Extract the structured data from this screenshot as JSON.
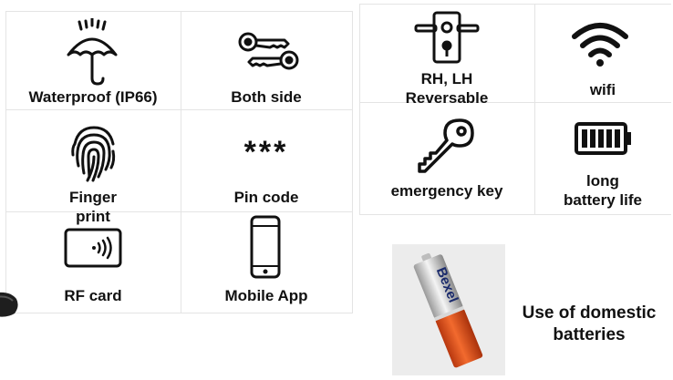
{
  "features": {
    "waterproof": "Waterproof (IP66)",
    "both_side": "Both side",
    "reversable_line1": "RH, LH",
    "reversable_line2": "Reversable",
    "wifi": "wifi",
    "finger_line1": "Finger",
    "finger_line2": "print",
    "pin_symbol": "***",
    "pin_code": "Pin code",
    "emergency_key": "emergency key",
    "battery_line1": "long",
    "battery_line2": "battery life",
    "rf_card": "RF card",
    "mobile_app": "Mobile App"
  },
  "promo": {
    "line1": "Use of domestic",
    "line2": "batteries",
    "battery_brand": "Bexel"
  },
  "icons": [
    "umbrella-icon",
    "keys-icon",
    "door-handle-icon",
    "wifi-icon",
    "fingerprint-icon",
    "key-icon",
    "battery-icon",
    "rf-card-icon",
    "smartphone-icon"
  ],
  "colors": {
    "grid": "#e4e4e4",
    "text": "#111111",
    "battery_orange": "#e8541f",
    "battery_silver": "#c9c9c9"
  }
}
